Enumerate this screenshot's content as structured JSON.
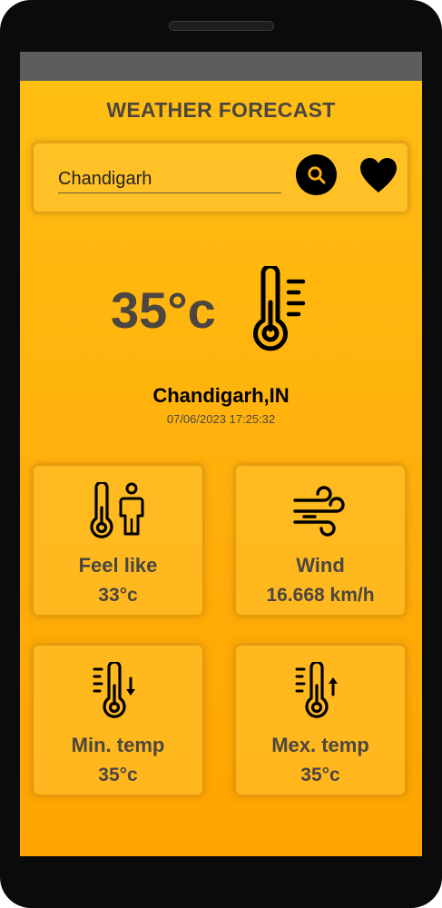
{
  "app": {
    "title": "WEATHER FORECAST"
  },
  "search": {
    "value": "Chandigarh",
    "search_icon": "search-icon",
    "favorite_icon": "heart-icon"
  },
  "current": {
    "temperature": "35°c",
    "icon": "thermometer-icon",
    "city": "Chandigarh,IN",
    "datetime": "07/06/2023 17:25:32"
  },
  "cards": [
    {
      "icon": "thermometer-person-icon",
      "label": "Feel like",
      "value": "33°c"
    },
    {
      "icon": "wind-icon",
      "label": "Wind",
      "value": "16.668 km/h"
    },
    {
      "icon": "thermometer-down-icon",
      "label": "Min. temp",
      "value": "35°c"
    },
    {
      "icon": "thermometer-up-icon",
      "label": "Mex. temp",
      "value": "35°c"
    }
  ],
  "colors": {
    "background_top": "#ffbf13",
    "background_bottom": "#ffa400",
    "text_primary": "#4b4640",
    "status_bar": "#5d5d5d"
  }
}
